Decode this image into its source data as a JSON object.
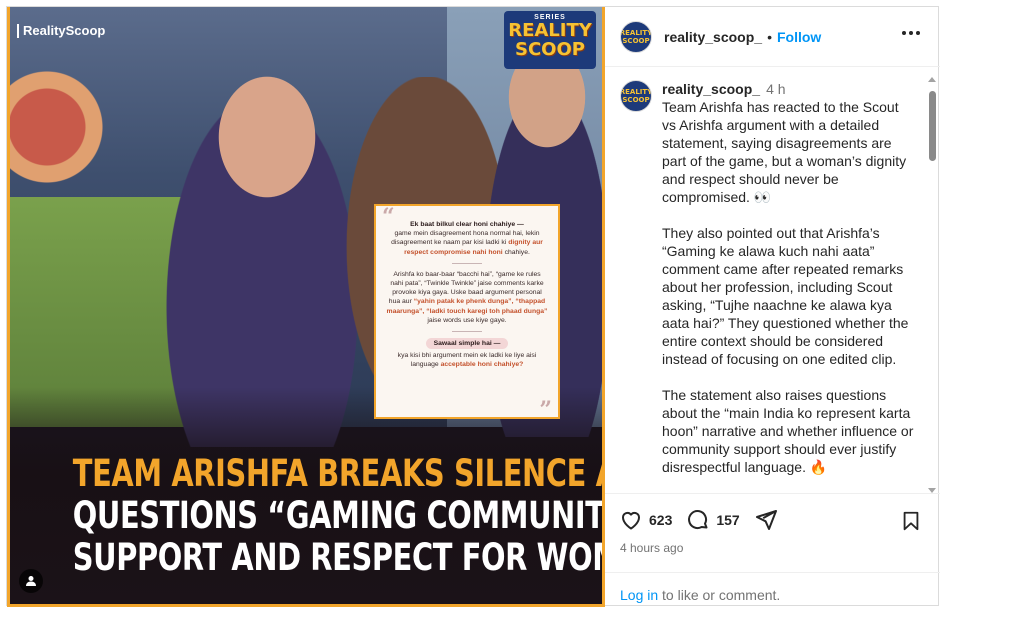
{
  "media": {
    "brand": "RealityScoop",
    "logo_small": "SERIES",
    "logo_line1": "REALITY",
    "logo_line2": "SCOOP",
    "quote": {
      "p1_bold": "Ek baat bilkul clear honi chahiye —",
      "p1_text": "game mein disagreement hona normal hai, lekin disagreement ke naam par kisi ladki ki",
      "p1_hl": "dignity aur respect compromise nahi honi",
      "p1_end": "chahiye.",
      "p2_a": "Arishfa ko baar-baar “bacchi hai”, “game ke rules nahi pata”, “Twinkle Twinkle” jaise comments karke provoke kiya gaya. Uske baad argument personal hua aur",
      "p2_hl": "“yahin patak ke phenk dunga”, “thappad maarunga”, “ladki touch karegi toh phaad dunga”",
      "p2_end": "jaise words use kiye gaye.",
      "pill": "Sawaal simple hai —",
      "p3_text": "kya kisi bhi argument mein ek ladki ke liye aisi language",
      "p3_hl": "acceptable honi chahiye?"
    },
    "headline": {
      "line1": "TEAM ARISHFA BREAKS SILENCE AND",
      "line2": "QUESTIONS “GAMING COMMUNITY”",
      "line3": "SUPPORT AND RESPECT FOR WOMEN!"
    }
  },
  "header": {
    "username": "reality_scoop_",
    "dot": "•",
    "follow": "Follow",
    "avatar_text": "REALITY SCOOP"
  },
  "caption": {
    "username": "reality_scoop_",
    "time": "4 h",
    "para1": "Team Arishfa has reacted to the Scout vs Arishfa argument with a detailed statement, saying disagreements are part of the game, but a woman’s dignity and respect should never be compromised. 👀",
    "para2": "They also pointed out that Arishfa’s “Gaming ke alawa kuch nahi aata” comment came after repeated remarks about her profession, including Scout asking, “Tujhe naachne ke alawa kya aata hai?” They questioned whether the entire context should be considered instead of focusing on one edited clip.",
    "para3": "The statement also raises questions about the “main India ko represent karta hoon” narrative and whether influence or community support should ever justify disrespectful language. 🔥"
  },
  "actions": {
    "likes": "623",
    "comments": "157",
    "time_ago": "4 hours ago"
  },
  "footer": {
    "login_link": "Log in",
    "login_rest": " to like or comment."
  },
  "colors": {
    "accent": "#f2a52b",
    "link": "#0095f6",
    "muted": "#737373"
  }
}
